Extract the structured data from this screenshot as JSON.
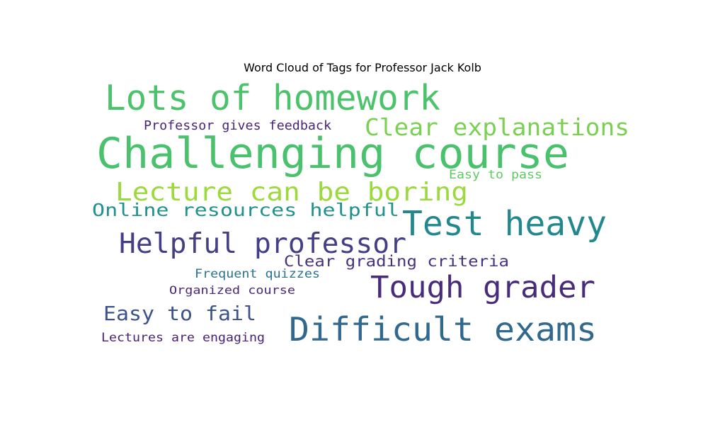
{
  "chart_data": {
    "type": "wordcloud",
    "title": "Word Cloud of Tags for Professor Jack Kolb",
    "words": [
      {
        "text": "Lots of homework",
        "color": "#4cc26b"
      },
      {
        "text": "Professor gives feedback",
        "color": "#482575"
      },
      {
        "text": "Clear explanations",
        "color": "#7ad151"
      },
      {
        "text": "Challenging course",
        "color": "#4ac16d"
      },
      {
        "text": "Easy to pass",
        "color": "#5ec962"
      },
      {
        "text": "Lecture can be boring",
        "color": "#9bd93c"
      },
      {
        "text": "Online resources helpful",
        "color": "#21918c"
      },
      {
        "text": "Test heavy",
        "color": "#23888e"
      },
      {
        "text": "Helpful professor",
        "color": "#433e85"
      },
      {
        "text": "Clear grading criteria",
        "color": "#46327e"
      },
      {
        "text": "Frequent quizzes",
        "color": "#2c728e"
      },
      {
        "text": "Tough grader",
        "color": "#472c7a"
      },
      {
        "text": "Organized course",
        "color": "#482878"
      },
      {
        "text": "Easy to fail",
        "color": "#3b528b"
      },
      {
        "text": "Difficult exams",
        "color": "#31688e"
      },
      {
        "text": "Lectures are engaging",
        "color": "#481f70"
      }
    ]
  }
}
